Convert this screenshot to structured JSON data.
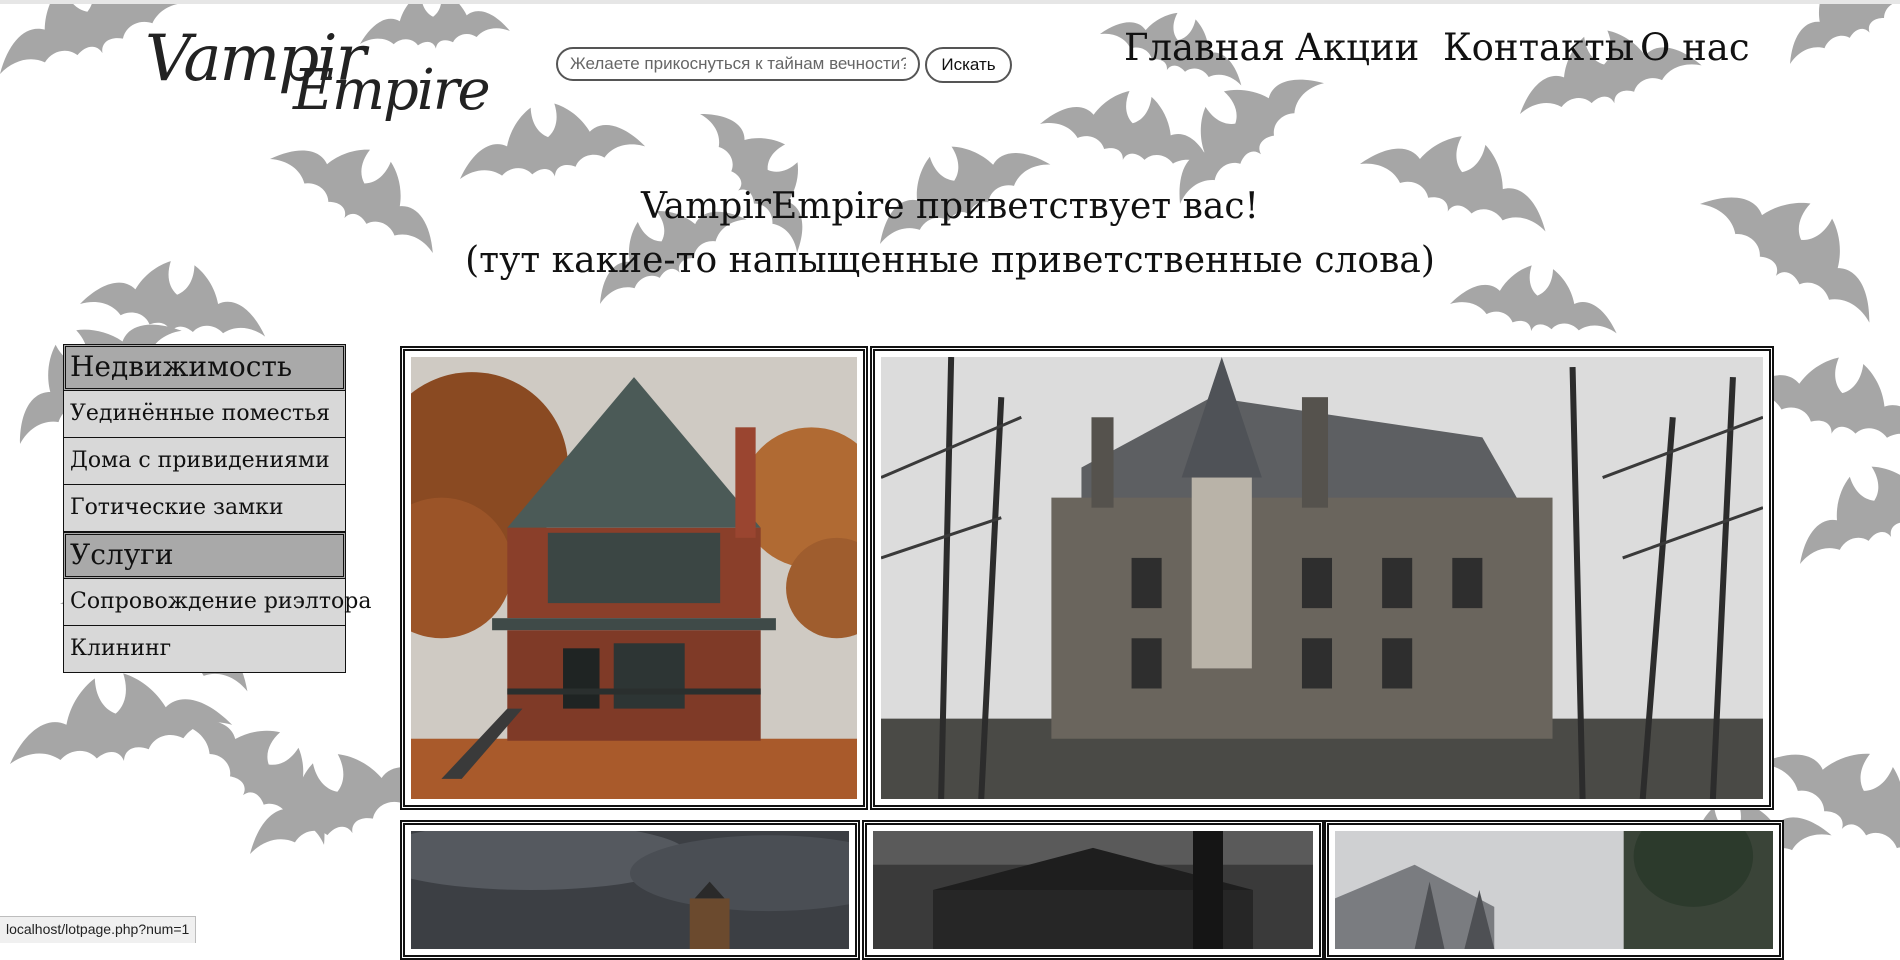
{
  "header": {
    "logo_line1": "Vampir",
    "logo_line2": "Empire",
    "search_placeholder": "Желаете прикоснуться к тайнам вечности?",
    "search_button": "Искать",
    "nav": [
      "Главная",
      "Акции",
      "Контакты",
      "О нас"
    ]
  },
  "greeting": {
    "line1": "VampirEmpire приветствует вас!",
    "line2": "(тут какие-то напыщенные приветственные слова)"
  },
  "sidebar": {
    "categories": [
      {
        "title": "Недвижимость",
        "items": [
          "Уединённые поместья",
          "Дома с привидениями",
          "Готические замки"
        ]
      },
      {
        "title": "Услуги",
        "items": [
          "Сопровождение риэлтора",
          "Клининг"
        ]
      }
    ]
  },
  "gallery": {
    "images": [
      "victorian-house-autumn",
      "abandoned-gothic-manor",
      "stormy-sky-tower",
      "dark-crypt",
      "gothic-castle-roof"
    ]
  },
  "status_bar": {
    "url": "localhost/lotpage.php?num=1"
  },
  "colors": {
    "background": "#ffffff",
    "bats": "#a6a6a6",
    "menu_header": "#a9a9a9",
    "menu_item": "#d8d8d8"
  },
  "icons": {
    "background_pattern": "bat-silhouette-icon"
  }
}
